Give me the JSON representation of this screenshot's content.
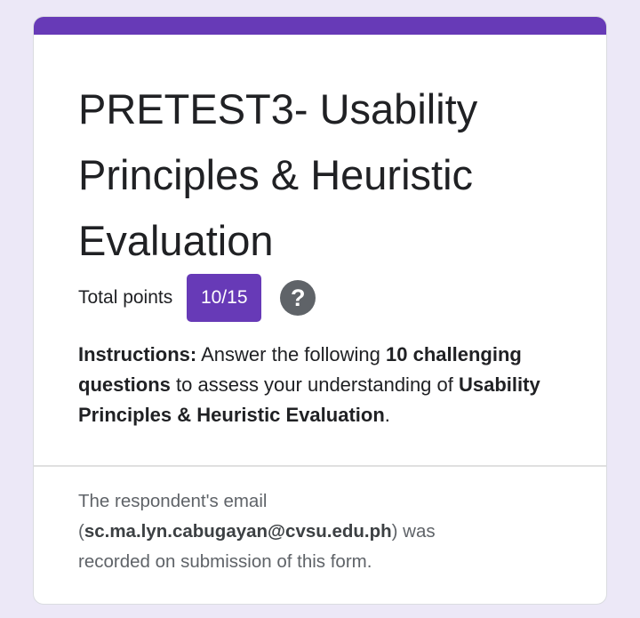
{
  "form": {
    "title": "PRETEST3- Usability Principles & Heuristic Evaluation",
    "total_points_label": "Total points",
    "score": "10/15",
    "help_icon_glyph": "?",
    "instructions": {
      "lead": "Instructions:",
      "text1": " Answer the following ",
      "bold1": "10 challenging questions",
      "text2": " to assess your understanding of ",
      "bold2": "Usability Principles & Heuristic Evaluation",
      "text3": "."
    },
    "email_note": {
      "prefix": "The respondent's email (",
      "email": "sc.ma.lyn.cabugayan@cvsu.edu.ph",
      "suffix": ") was recorded on submission of this form."
    }
  },
  "colors": {
    "accent": "#673ab7",
    "background": "#ece8f7",
    "card": "#ffffff"
  },
  "icons": [
    "help-icon"
  ]
}
